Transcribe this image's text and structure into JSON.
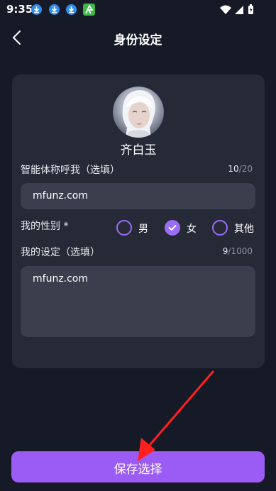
{
  "status_bar": {
    "time": "9:35"
  },
  "nav": {
    "title": "身份设定"
  },
  "profile": {
    "name": "齐白玉"
  },
  "nickname": {
    "label": "智能体称呼我（选填）",
    "count_current": "10",
    "count_max": "/20",
    "value": "mfunz.com"
  },
  "gender": {
    "label": "我的性别 *",
    "options": [
      {
        "label": "男",
        "checked": false
      },
      {
        "label": "女",
        "checked": true
      },
      {
        "label": "其他",
        "checked": false
      }
    ]
  },
  "persona": {
    "label": "我的设定（选填）",
    "count_current": "9",
    "count_max": "/1000",
    "value": "mfunz.com"
  },
  "save_button": {
    "label": "保存选择"
  },
  "colors": {
    "accent": "#9b5cf5",
    "annotation_arrow": "#ff1f1f"
  }
}
